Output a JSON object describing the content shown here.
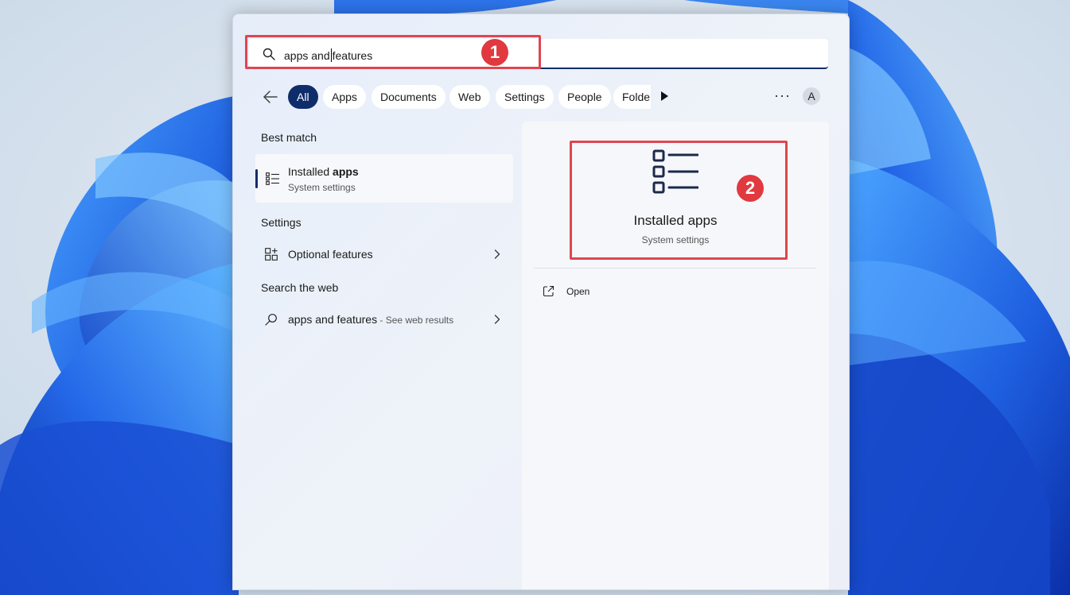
{
  "search": {
    "query_before_caret": "apps and",
    "query_after_caret": "features"
  },
  "annotations": {
    "one": "1",
    "two": "2"
  },
  "filters": {
    "pills": [
      "All",
      "Apps",
      "Documents",
      "Web",
      "Settings",
      "People",
      "Folde"
    ],
    "active": "All"
  },
  "account": {
    "initial": "A"
  },
  "sections": {
    "best_match": "Best match",
    "settings": "Settings",
    "search_web": "Search the web"
  },
  "best_match": {
    "title_plain": "Installed ",
    "title_bold": "apps",
    "subtitle": "System settings"
  },
  "settings_item": {
    "label_plain": "Optional ",
    "label_bold": "features"
  },
  "web_item": {
    "query": "apps and features",
    "suffix": " - See web results"
  },
  "details": {
    "title": "Installed apps",
    "subtitle": "System settings",
    "actions": [
      "Open"
    ]
  },
  "colors": {
    "accent": "#0f2d6b",
    "annotation": "#e0393f"
  }
}
